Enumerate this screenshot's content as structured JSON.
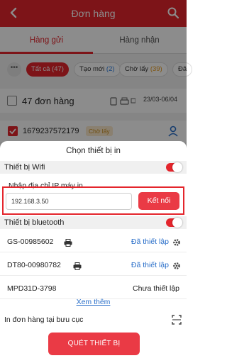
{
  "app_bar": {
    "title": "Đơn hàng"
  },
  "tabs": [
    {
      "label": "Hàng gửi",
      "active": true
    },
    {
      "label": "Hàng nhận",
      "active": false
    }
  ],
  "filters": {
    "more": "•••",
    "chips": [
      {
        "label": "Tất cả",
        "count": "(47)",
        "selected": true
      },
      {
        "label": "Tạo mới",
        "count": "(2)",
        "selected": false
      },
      {
        "label": "Chờ lấy",
        "count": "(39)",
        "selected": false
      },
      {
        "label": "Đã",
        "count": "",
        "selected": false
      }
    ]
  },
  "summary": {
    "order_count": "47 đơn hàng",
    "date_range": "23/03-06/04"
  },
  "order": {
    "id": "1679237572179",
    "status": "Chờ lấy"
  },
  "sheet": {
    "title": "Chọn thiết bị in",
    "wifi": {
      "label": "Thiết bị Wifi",
      "enabled": true
    },
    "ip_label": "Nhập địa chỉ IP máy in",
    "ip_value": "192.168.3.50",
    "connect_label": "Kết nối",
    "bluetooth": {
      "label": "Thiết bị bluetooth",
      "enabled": true
    },
    "devices": [
      {
        "name": "GS-00985602",
        "status": "Đã thiết lập",
        "configured": true
      },
      {
        "name": "DT80-00980782",
        "status": "Đã thiết lập",
        "configured": true
      },
      {
        "name": "MPD31D-3798",
        "status": "Chưa thiết lập",
        "configured": false
      }
    ],
    "see_more": "Xem thêm",
    "post_office_label": "In đơn hàng tại bưu cục",
    "scan_button": "QUÉT THIẾT BỊ"
  },
  "colors": {
    "brand_red": "#e4252c",
    "link_blue": "#2a6fc9",
    "pending_orange": "#c98a18"
  },
  "icons": [
    "back-chevron-icon",
    "search-icon",
    "printer-icon",
    "calendar-icon",
    "person-pin-icon",
    "gear-icon",
    "scan-icon"
  ]
}
